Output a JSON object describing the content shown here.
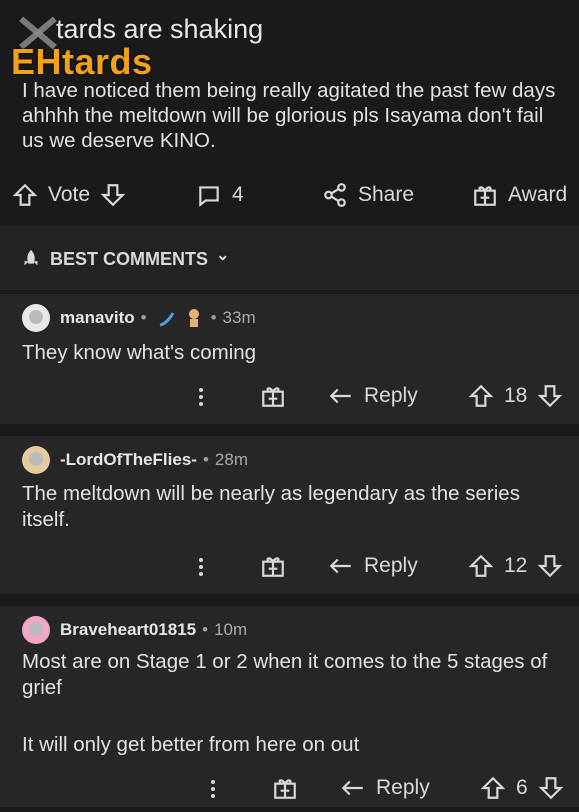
{
  "post": {
    "title_visible": "tards are shaking",
    "watermark": "EHtards",
    "body": "I have noticed them being really agitated the past few days ahhhh the meltdown will be glorious pls Isayama don't fail us we deserve KINO.",
    "actions": {
      "vote": "Vote",
      "comments_count": "4",
      "share": "Share",
      "award": "Award"
    }
  },
  "sort": {
    "label": "BEST COMMENTS",
    "chevron": "⌄"
  },
  "comments": [
    {
      "username": "manavito",
      "dot": "•",
      "time": "33m",
      "text": "They know what's coming",
      "reply": "Reply",
      "votes": "18"
    },
    {
      "username": "-LordOfTheFlies-",
      "dot": "•",
      "time": "28m",
      "text": "The meltdown will be nearly as legendary as the series itself.",
      "reply": "Reply",
      "votes": "12"
    },
    {
      "username": "Braveheart01815",
      "dot": "•",
      "time": "10m",
      "text1": "Most are on Stage 1 or 2 when it comes to the 5 stages of grief",
      "text2": "It will only get better from here on out",
      "reply": "Reply",
      "votes": "6"
    }
  ],
  "icons": {
    "up": "arrow-up-icon",
    "down": "arrow-down-icon",
    "comment": "comment-icon",
    "share": "share-icon",
    "award": "gift-icon",
    "reply": "reply-icon",
    "more": "more-vertical-icon",
    "sort": "rocket-icon"
  }
}
